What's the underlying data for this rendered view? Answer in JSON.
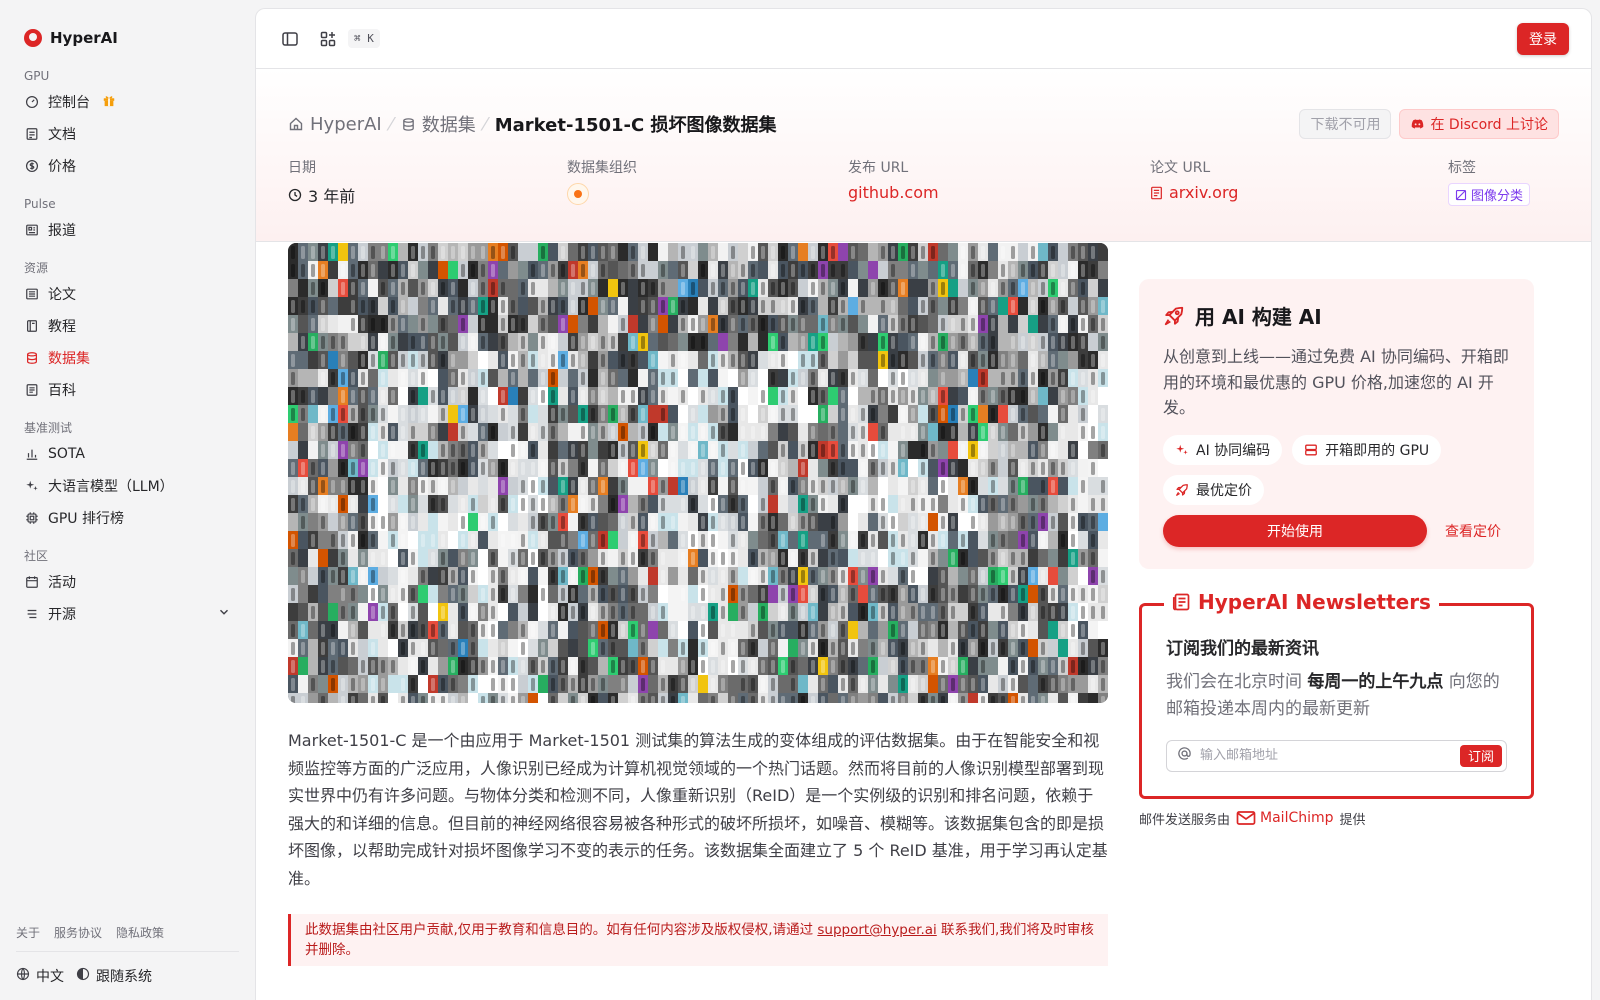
{
  "brand": {
    "name": "HyperAI"
  },
  "sidebar": {
    "groups": [
      {
        "label": "GPU",
        "items": [
          {
            "label": "控制台",
            "icon": "gauge-icon"
          },
          {
            "label": "文档",
            "icon": "doc-icon"
          },
          {
            "label": "价格",
            "icon": "dollar-icon"
          }
        ]
      },
      {
        "label": "Pulse",
        "items": [
          {
            "label": "报道",
            "icon": "news-icon"
          }
        ]
      },
      {
        "label": "资源",
        "items": [
          {
            "label": "论文",
            "icon": "paper-icon"
          },
          {
            "label": "教程",
            "icon": "book-icon"
          },
          {
            "label": "数据集",
            "icon": "database-icon",
            "active": true
          },
          {
            "label": "百科",
            "icon": "wiki-icon"
          }
        ]
      },
      {
        "label": "基准测试",
        "items": [
          {
            "label": "SOTA",
            "icon": "bar-chart-icon"
          },
          {
            "label": "大语言模型（LLM）",
            "icon": "sparkle-icon"
          },
          {
            "label": "GPU 排行榜",
            "icon": "chip-icon"
          }
        ]
      },
      {
        "label": "社区",
        "items": [
          {
            "label": "活动",
            "icon": "calendar-icon"
          },
          {
            "label": "开源",
            "icon": "list-icon"
          }
        ]
      }
    ],
    "footer_links": [
      "关于",
      "服务协议",
      "隐私政策"
    ],
    "language": "中文",
    "theme": "跟随系统"
  },
  "topbar": {
    "shortcut": "⌘ K",
    "login_label": "登录"
  },
  "breadcrumb": {
    "home": "HyperAI",
    "section": "数据集",
    "current": "Market-1501-C 损坏图像数据集"
  },
  "hero_actions": {
    "download": "下载不可用",
    "discord": "在 Discord 上讨论"
  },
  "meta": {
    "date_label": "日期",
    "date_value": "3 年前",
    "org_label": "数据集组织",
    "publish_label": "发布 URL",
    "publish_value": "github.com",
    "paper_label": "论文 URL",
    "paper_value": "arxiv.org",
    "tags_label": "标签",
    "tag_value": "图像分类"
  },
  "description": "Market-1501-C 是一个由应用于 Market-1501 测试集的算法生成的变体组成的评估数据集。由于在智能安全和视频监控等方面的广泛应用，人像识别已经成为计算机视觉领域的一个热门话题。然而将目前的人像识别模型部署到现实世界中仍有许多问题。与物体分类和检测不同，人像重新识别（ReID）是一个实例级的识别和排名问题，依赖于强大的和详细的信息。但目前的神经网络很容易被各种形式的破坏所损坏，如噪音、模糊等。该数据集包含的即是损坏图像，以帮助完成针对损坏图像学习不变的表示的任务。该数据集全面建立了 5 个 ReID 基准，用于学习再认定基准。",
  "notice": {
    "before": "此数据集由社区用户贡献,仅用于教育和信息目的。如有任何内容涉及版权侵权,请通过 ",
    "email": "support@hyper.ai",
    "after": " 联系我们,我们将及时审核并删除。"
  },
  "promo": {
    "title": "用 AI 构建 AI",
    "desc": "从创意到上线——通过免费 AI 协同编码、开箱即用的环境和最优惠的 GPU 价格,加速您的 AI 开发。",
    "chips": [
      "AI 协同编码",
      "开箱即用的 GPU",
      "最优定价"
    ],
    "start": "开始使用",
    "pricing": "查看定价"
  },
  "newsletter": {
    "title": "HyperAI Newsletters",
    "heading": "订阅我们的最新资讯",
    "text_before": "我们会在北京时间 ",
    "text_bold": "每周一的上午九点",
    "text_after": " 向您的邮箱投递本周内的最新更新",
    "placeholder": "输入邮箱地址",
    "subscribe": "订阅",
    "note_before": "邮件发送服务由",
    "note_brand": "MailChimp",
    "note_after": "提供"
  },
  "colors": {
    "accent": "#dc2626",
    "tint": "#fef2f2"
  }
}
